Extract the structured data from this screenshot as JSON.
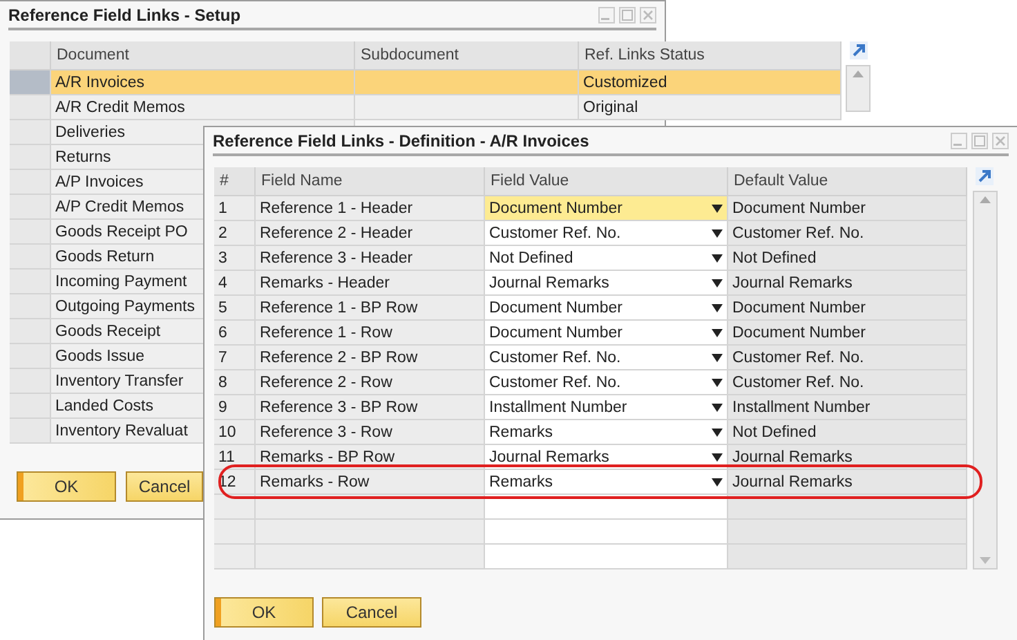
{
  "setup_window": {
    "title": "Reference Field Links - Setup",
    "columns": [
      "Document",
      "Subdocument",
      "Ref. Links Status"
    ],
    "rows": [
      {
        "document": "A/R Invoices",
        "subdocument": "",
        "status": "Customized",
        "selected": true
      },
      {
        "document": "A/R Credit Memos",
        "subdocument": "",
        "status": "Original",
        "selected": false
      },
      {
        "document": "Deliveries",
        "selected": false
      },
      {
        "document": "Returns",
        "selected": false
      },
      {
        "document": "A/P Invoices",
        "selected": false
      },
      {
        "document": "A/P Credit Memos",
        "selected": false
      },
      {
        "document": "Goods Receipt PO",
        "selected": false
      },
      {
        "document": "Goods Return",
        "selected": false
      },
      {
        "document": "Incoming Payment",
        "selected": false
      },
      {
        "document": "Outgoing Payments",
        "selected": false
      },
      {
        "document": "Goods Receipt",
        "selected": false
      },
      {
        "document": "Goods Issue",
        "selected": false
      },
      {
        "document": "Inventory Transfer",
        "selected": false
      },
      {
        "document": "Landed Costs",
        "selected": false
      },
      {
        "document": "Inventory Revaluat",
        "selected": false
      }
    ],
    "buttons": [
      {
        "label": "OK",
        "default": true
      },
      {
        "label": "Cancel",
        "default": false
      }
    ]
  },
  "definition_window": {
    "title": "Reference Field Links - Definition - A/R Invoices",
    "columns": [
      "#",
      "Field Name",
      "Field Value",
      "Default Value"
    ],
    "rows": [
      {
        "number": "1",
        "field_name": "Reference 1 - Header",
        "field_value": "Document Number",
        "default_value": "Document Number",
        "selected": true,
        "highlighted": false
      },
      {
        "number": "2",
        "field_name": "Reference 2 - Header",
        "field_value": "Customer Ref. No.",
        "default_value": "Customer Ref. No.",
        "selected": false,
        "highlighted": false
      },
      {
        "number": "3",
        "field_name": "Reference 3 - Header",
        "field_value": "Not Defined",
        "default_value": "Not Defined",
        "selected": false,
        "highlighted": false
      },
      {
        "number": "4",
        "field_name": "Remarks - Header",
        "field_value": "Journal Remarks",
        "default_value": "Journal Remarks",
        "selected": false,
        "highlighted": false
      },
      {
        "number": "5",
        "field_name": "Reference 1 - BP Row",
        "field_value": "Document Number",
        "default_value": "Document Number",
        "selected": false,
        "highlighted": false
      },
      {
        "number": "6",
        "field_name": "Reference 1 - Row",
        "field_value": "Document Number",
        "default_value": "Document Number",
        "selected": false,
        "highlighted": false
      },
      {
        "number": "7",
        "field_name": "Reference 2 - BP Row",
        "field_value": "Customer Ref. No.",
        "default_value": "Customer Ref. No.",
        "selected": false,
        "highlighted": false
      },
      {
        "number": "8",
        "field_name": "Reference 2 - Row",
        "field_value": "Customer Ref. No.",
        "default_value": "Customer Ref. No.",
        "selected": false,
        "highlighted": false
      },
      {
        "number": "9",
        "field_name": "Reference 3 - BP Row",
        "field_value": "Installment Number",
        "default_value": "Installment Number",
        "selected": false,
        "highlighted": false
      },
      {
        "number": "10",
        "field_name": "Reference 3 - Row",
        "field_value": "Remarks",
        "default_value": "Not Defined",
        "selected": false,
        "highlighted": false
      },
      {
        "number": "11",
        "field_name": "Remarks - BP Row",
        "field_value": "Journal Remarks",
        "default_value": "Journal Remarks",
        "selected": false,
        "highlighted": false
      },
      {
        "number": "12",
        "field_name": "Remarks - Row",
        "field_value": "Remarks",
        "default_value": "Journal Remarks",
        "selected": false,
        "highlighted": true
      }
    ],
    "buttons": [
      {
        "label": "OK",
        "default": true
      },
      {
        "label": "Cancel",
        "default": false
      }
    ]
  }
}
